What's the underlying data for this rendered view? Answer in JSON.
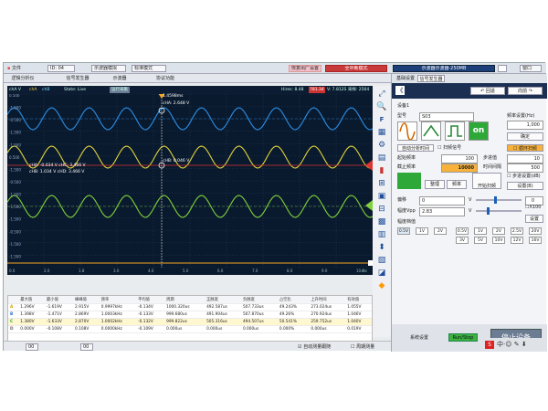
{
  "toolbar": {
    "file": "文件",
    "device": "ID: 04",
    "mode": "示波器模拟",
    "std": "标准模式",
    "factory": "恢复出厂设置",
    "fullscreen": "全中断模式",
    "vch": "示波器示波器·250MB",
    "close": "退出",
    "window": "窗口"
  },
  "tabs": [
    "逻辑分析仪",
    "信号发生器",
    "示波器",
    "协议功能"
  ],
  "scope": {
    "ch_a": "chA",
    "ch_b": "chB",
    "state": "State: Live",
    "run": "运行采集",
    "info": "Hires: 8.48",
    "rate": "781.34",
    "ch_info": "V: 7.812S   采样: 2564",
    "cursor_time": "1.4598ms",
    "cursor_a1": "cHA: 2.648 V",
    "cursor_b1": "cHB: 0.046 V",
    "meas1": "cHA: -0.034 V  cHC: 3.466 V",
    "meas2": "cHB: 1.034 V  cHD: 3.466 V",
    "yticks": [
      "0.500",
      "-1.500",
      "-0.500",
      "-1.500",
      "-1.500",
      "0.500",
      "-1.500",
      "-0.500",
      "-1.500",
      "-1.500",
      "-1.500",
      "-0.500",
      "-1.500",
      "-1.500"
    ],
    "xticks": [
      "0.0",
      "2.0",
      "1.8",
      "3.0",
      "4.0",
      "5.0",
      "6.0",
      "7.0",
      "8.0",
      "9.0",
      "10.0"
    ],
    "unit": "ms",
    "yunit": "chA V"
  },
  "meas": {
    "headers": [
      "",
      "最大值",
      "最小值",
      "峰峰值",
      "频率",
      "平均值",
      "周期",
      "正脉宽",
      "负脉宽",
      "占空比",
      "上升时间",
      "有效值"
    ],
    "rows": [
      [
        "A",
        "1.296V",
        "-1.619V",
        "2.915V",
        "0.9997kHz",
        "-0.134V",
        "1000.320us",
        "492.587us",
        "507.733us",
        "49.243%",
        "273.024us",
        "1.055V"
      ],
      [
        "B",
        "1.398V",
        "-1.471V",
        "2.869V",
        "1.0003kHz",
        "-0.133V",
        "999.680us",
        "491.904us",
        "507.870us",
        "49.26%",
        "270.924us",
        "1.046V"
      ],
      [
        "C",
        "1.380V",
        "-1.633V",
        "2.870V",
        "1.0002kHz",
        "-0.132V",
        "999.822us",
        "505.316us",
        "494.507us",
        "50.541%",
        "259.752us",
        "1.040V"
      ],
      [
        "D",
        "0.000V",
        "-0.108V",
        "0.108V",
        "0.0000kHz",
        "-0.109V",
        "0.000us",
        "0.000us",
        "0.000us",
        "0.000%",
        "0.000us",
        "0.019V"
      ]
    ]
  },
  "status": {
    "a": "00",
    "b": "00",
    "auto": "自动测量跟随",
    "persist": "周期测量"
  },
  "panel": {
    "tabs": [
      "基础设置",
      "信号发生器"
    ],
    "back": "《",
    "undo": "回退",
    "fwd": "向前",
    "ch1": "设备1",
    "type_lbl": "型号",
    "type_val": "S03",
    "onoff": "on",
    "ptlbl": "频率设置(Hz)",
    "freq": "1,000",
    "apply": "确定",
    "auto": "自动分析时间",
    "sweep": "扫频信号",
    "loop": "循环扫频",
    "start_lbl": "起始频率",
    "start": "100",
    "step_lbl": "步进值",
    "step": "10",
    "end_lbl": "截止频率",
    "end": "10000",
    "time_lbl": "时间间隔",
    "time": "500",
    "cfg_lbl": "步进设置(dB)",
    "setok": "设置(B)",
    "ex": "整理",
    "load": "频率",
    "off": "开始扫频",
    "offset_lbl": "偏移",
    "offset": "0",
    "offset_u": "V",
    "vpp_lbl": "幅度Vpp",
    "vpp": "2.83",
    "vpp_u": "V",
    "preset_lbl": "幅度档值",
    "x100": "X100",
    "set": "设置",
    "amps": [
      "0.5V",
      "1V",
      "2V",
      "0.5V",
      "1V",
      "2V",
      "2.5V",
      "3V",
      "5V",
      "10V",
      "12V",
      "16V",
      "20V"
    ],
    "sys": "系统设置",
    "run": "Run/Stop",
    "stop": "停止设备"
  }
}
